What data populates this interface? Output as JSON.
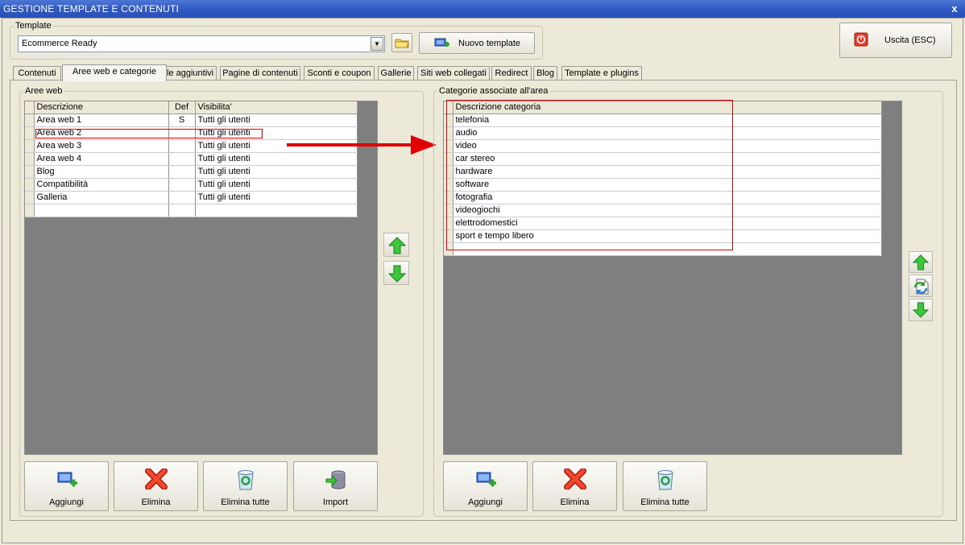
{
  "window": {
    "title": "GESTIONE TEMPLATE E CONTENUTI",
    "close_label": "x"
  },
  "template_group": {
    "legend": "Template",
    "selected": "Ecommerce Ready",
    "new_button": "Nuovo template"
  },
  "exit_button": "Uscita (ESC)",
  "tabs": [
    "Contenuti",
    "Aree web e categorie",
    "File aggiuntivi",
    "Pagine di contenuti",
    "Sconti e coupon",
    "Gallerie",
    "Siti web collegati",
    "Redirect",
    "Blog",
    "Template e plugins"
  ],
  "aree_web": {
    "legend": "Aree web",
    "columns": [
      "Descrizione",
      "Def",
      "Visibilita'"
    ],
    "rows": [
      [
        "Area web 1",
        "S",
        "Tutti gli utenti"
      ],
      [
        "Area web 2",
        "",
        "Tutti gli utenti"
      ],
      [
        "Area web 3",
        "",
        "Tutti gli utenti"
      ],
      [
        "Area web 4",
        "",
        "Tutti gli utenti"
      ],
      [
        "Blog",
        "",
        "Tutti gli utenti"
      ],
      [
        "Compatibilità",
        "",
        "Tutti gli utenti"
      ],
      [
        "Galleria",
        "",
        "Tutti gli utenti"
      ]
    ],
    "buttons": [
      "Aggiungi",
      "Elimina",
      "Elimina tutte",
      "Import"
    ]
  },
  "categorie": {
    "legend": "Categorie associate all'area",
    "column": "Descrizione categoria",
    "rows": [
      "telefonia",
      "audio",
      "video",
      "car stereo",
      "hardware",
      "software",
      "fotografia",
      "videogiochi",
      "elettrodomestici",
      "sport e tempo libero"
    ],
    "buttons": [
      "Aggiungi",
      "Elimina",
      "Elimina tutte"
    ]
  },
  "colors": {
    "titlebar": "#2e58c0",
    "annotation_red": "#e00000",
    "arrow_green": "#3cc63c",
    "grid_background": "#807f80"
  }
}
